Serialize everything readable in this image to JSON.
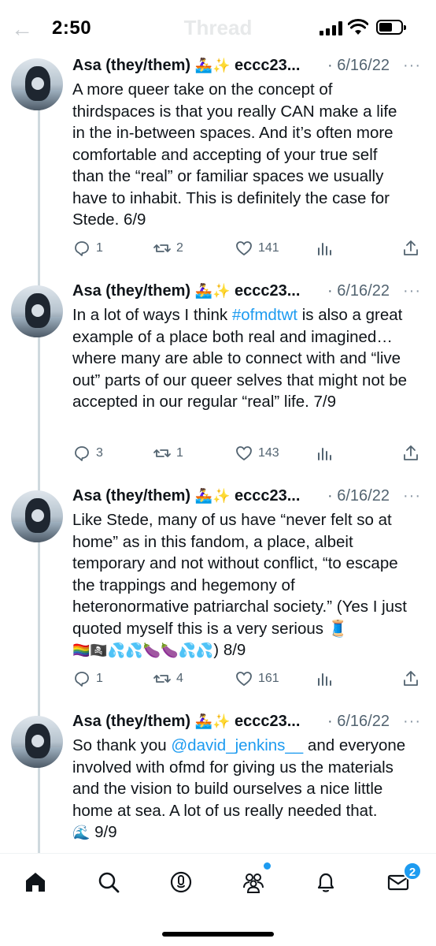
{
  "status_bar": {
    "time": "2:50",
    "battery_level": 0.6
  },
  "nav": {
    "title": "Thread"
  },
  "tweets": [
    {
      "name": "Asa (they/them)",
      "name_emoji": "🚣‍♀️✨",
      "handle": "eccc23...",
      "date": "· 6/16/22",
      "more": "···",
      "text_parts": [
        "A more queer take on the concept of thirdspaces is that you really CAN make a life in the in-between spaces. And it’s often more comfortable and accepting of your true self than the “real” or familiar spaces we usually have to inhabit. This is definitely the case for Stede. 6/9"
      ],
      "replies": "1",
      "retweets": "2",
      "likes": "141"
    },
    {
      "name": "Asa (they/them)",
      "name_emoji": "🚣‍♀️✨",
      "handle": "eccc23...",
      "date": "· 6/16/22",
      "more": "···",
      "text_before": "In a lot of ways I think ",
      "hashtag": "#ofmdtwt",
      "text_after": " is also a great example of a place both real and imagined… where many are able to connect with and “live out” parts of our queer selves that might not be accepted in our regular “real” life. 7/9",
      "replies": "3",
      "retweets": "1",
      "likes": "143"
    },
    {
      "name": "Asa (they/them)",
      "name_emoji": "🚣‍♀️✨",
      "handle": "eccc23...",
      "date": "· 6/16/22",
      "more": "···",
      "text": "Like Stede, many of us have “never felt so at home” as in this fandom, a place, albeit temporary and not without conflict, “to escape the trappings and hegemony of heteronormative patriarchal society.” (Yes I just quoted myself this is a very serious 🧵",
      "emoji_line": "🏳️‍🌈🏴‍☠️💦💦🍆🍆💦💦",
      "text_end": ") 8/9",
      "replies": "1",
      "retweets": "4",
      "likes": "161"
    },
    {
      "name": "Asa (they/them)",
      "name_emoji": "🚣‍♀️✨",
      "handle": "eccc23...",
      "date": "· 6/16/22",
      "more": "···",
      "text_before": "So thank you ",
      "mention": "@david_jenkins__",
      "text_after": " and everyone involved with ofmd for giving us the materials and the vision to build ourselves a nice little home at sea. A lot of us really needed that.",
      "text_end_emoji": "🌊",
      "text_end": " 9/9"
    }
  ],
  "tabbar": {
    "messages_badge": "2",
    "icons": [
      "home-icon",
      "search-icon",
      "spaces-icon",
      "communities-icon",
      "notifications-icon",
      "messages-icon"
    ]
  },
  "colors": {
    "link": "#1d9bf0",
    "text": "#0f1419",
    "secondary": "#536471"
  }
}
